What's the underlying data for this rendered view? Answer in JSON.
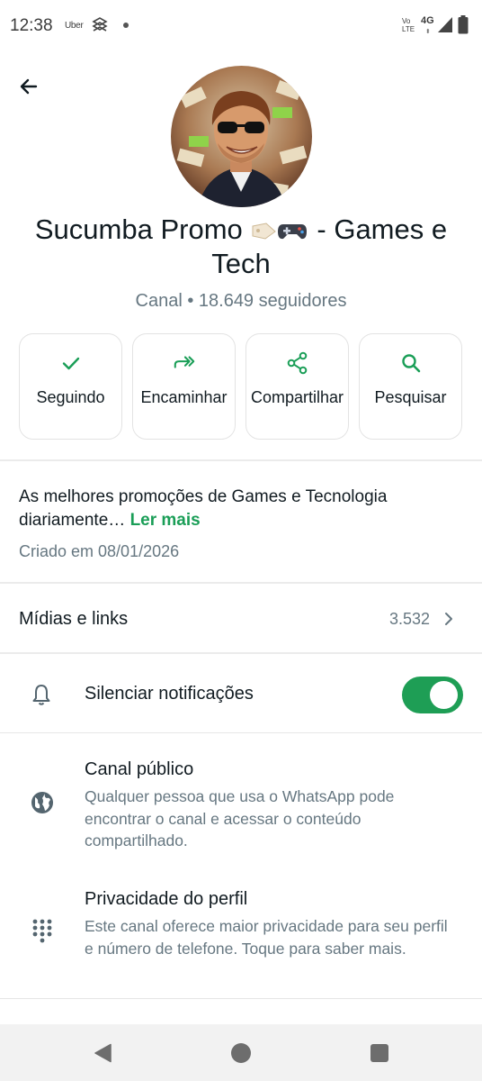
{
  "status_bar": {
    "time": "12:38",
    "uber_label": "Uber",
    "volte_label_1": "Vo",
    "volte_label_2": "LTE",
    "network": "4G",
    "icons": [
      "uber-icon",
      "bank-icon",
      "notification-dot",
      "signal-icon",
      "battery-icon"
    ]
  },
  "header": {
    "back_icon": "arrow-left-icon"
  },
  "channel": {
    "name_part1": "Sucumba Promo",
    "name_part2": "- Games e Tech",
    "subtitle": "Canal • 18.649 seguidores"
  },
  "actions": [
    {
      "label": "Seguindo",
      "icon": "check-icon"
    },
    {
      "label": "Encaminhar",
      "icon": "forward-icon"
    },
    {
      "label": "Compartilhar",
      "icon": "share-icon"
    },
    {
      "label": "Pesquisar",
      "icon": "search-icon"
    }
  ],
  "description": {
    "text": "As melhores promoções de Games e Tecnologia diariamente…",
    "read_more": "Ler mais",
    "created": "Criado em 08/01/2026"
  },
  "media": {
    "label": "Mídias e links",
    "count": "3.532"
  },
  "mute": {
    "label": "Silenciar notificações",
    "enabled": true
  },
  "info": [
    {
      "title": "Canal público",
      "body": "Qualquer pessoa que usa o WhatsApp pode encontrar o canal e acessar o conteúdo compartilhado.",
      "icon": "globe-icon"
    },
    {
      "title": "Privacidade do perfil",
      "body": "Este canal oferece maior privacidade para seu perfil e número de telefone. Toque para saber mais.",
      "icon": "dialpad-icon"
    }
  ],
  "colors": {
    "accent_green": "#1a9e57",
    "toggle_green": "#1e9e55",
    "secondary_text": "#667781"
  }
}
